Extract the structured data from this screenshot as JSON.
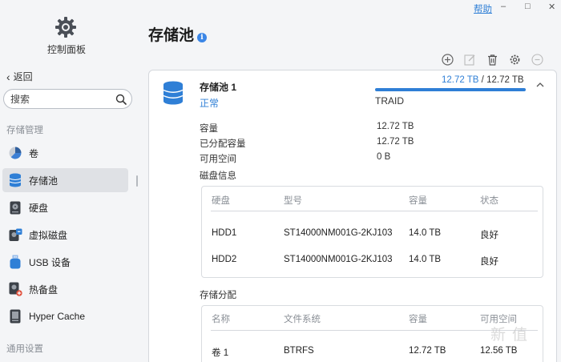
{
  "window": {
    "help_label": "帮助",
    "minimize": "–",
    "maximize": "□",
    "close": "✕"
  },
  "sidebar": {
    "app_title": "控制面板",
    "back_label": "返回",
    "search_placeholder": "搜索",
    "section_storage": "存储管理",
    "items": [
      {
        "label": "卷",
        "icon": "volume-pie-icon"
      },
      {
        "label": "存储池",
        "icon": "storage-pool-icon",
        "active": true
      },
      {
        "label": "硬盘",
        "icon": "hard-disk-icon"
      },
      {
        "label": "虚拟磁盘",
        "icon": "virtual-disk-icon"
      },
      {
        "label": "USB 设备",
        "icon": "usb-device-icon"
      },
      {
        "label": "热备盘",
        "icon": "hot-spare-icon"
      },
      {
        "label": "Hyper Cache",
        "icon": "hyper-cache-icon"
      }
    ],
    "section_general": "通用设置"
  },
  "main": {
    "title": "存储池",
    "toolbar": [
      "add-icon",
      "edit-icon",
      "delete-icon",
      "settings-icon",
      "more-icon"
    ]
  },
  "pool": {
    "name": "存储池 1",
    "status": "正常",
    "used": "12.72 TB",
    "separator": "/",
    "total": "12.72 TB",
    "usage_fraction": 1.0,
    "raid": "TRAID",
    "capacity_label": "容量",
    "capacity_value": "12.72 TB",
    "allocated_label": "已分配容量",
    "allocated_value": "12.72 TB",
    "free_label": "可用空间",
    "free_value": "0 B",
    "disk_info_title": "磁盘信息",
    "disk_table": {
      "headers": [
        "硬盘",
        "型号",
        "容量",
        "状态"
      ],
      "rows": [
        [
          "HDD1",
          "ST14000NM001G-2KJ103",
          "14.0 TB",
          "良好"
        ],
        [
          "HDD2",
          "ST14000NM001G-2KJ103",
          "14.0 TB",
          "良好"
        ]
      ]
    },
    "alloc_title": "存储分配",
    "alloc_table": {
      "headers": [
        "名称",
        "文件系统",
        "容量",
        "可用空间"
      ],
      "rows": [
        [
          "卷 1",
          "BTRFS",
          "12.72 TB",
          "12.56 TB"
        ]
      ]
    }
  },
  "watermark": "新 值"
}
